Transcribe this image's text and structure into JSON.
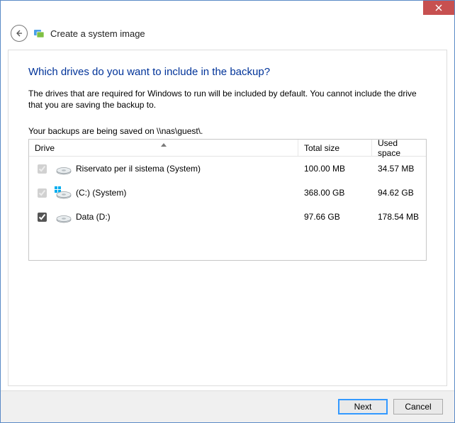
{
  "window": {
    "title": "Create a system image"
  },
  "page": {
    "question": "Which drives do you want to include in the backup?",
    "explain": "The drives that are required for Windows to run will be included by default. You cannot include the drive that you are saving the backup to.",
    "save_location_line": "Your backups are being saved on \\\\nas\\guest\\."
  },
  "columns": {
    "drive": "Drive",
    "total": "Total size",
    "used": "Used space"
  },
  "drives": [
    {
      "checked": true,
      "disabled": true,
      "label": "Riservato per il sistema (System)",
      "total": "100.00 MB",
      "used": "34.57 MB",
      "os": false
    },
    {
      "checked": true,
      "disabled": true,
      "label": "(C:) (System)",
      "total": "368.00 GB",
      "used": "94.62 GB",
      "os": true
    },
    {
      "checked": true,
      "disabled": false,
      "label": "Data (D:)",
      "total": "97.66 GB",
      "used": "178.54 MB",
      "os": false
    }
  ],
  "buttons": {
    "next": "Next",
    "cancel": "Cancel"
  }
}
